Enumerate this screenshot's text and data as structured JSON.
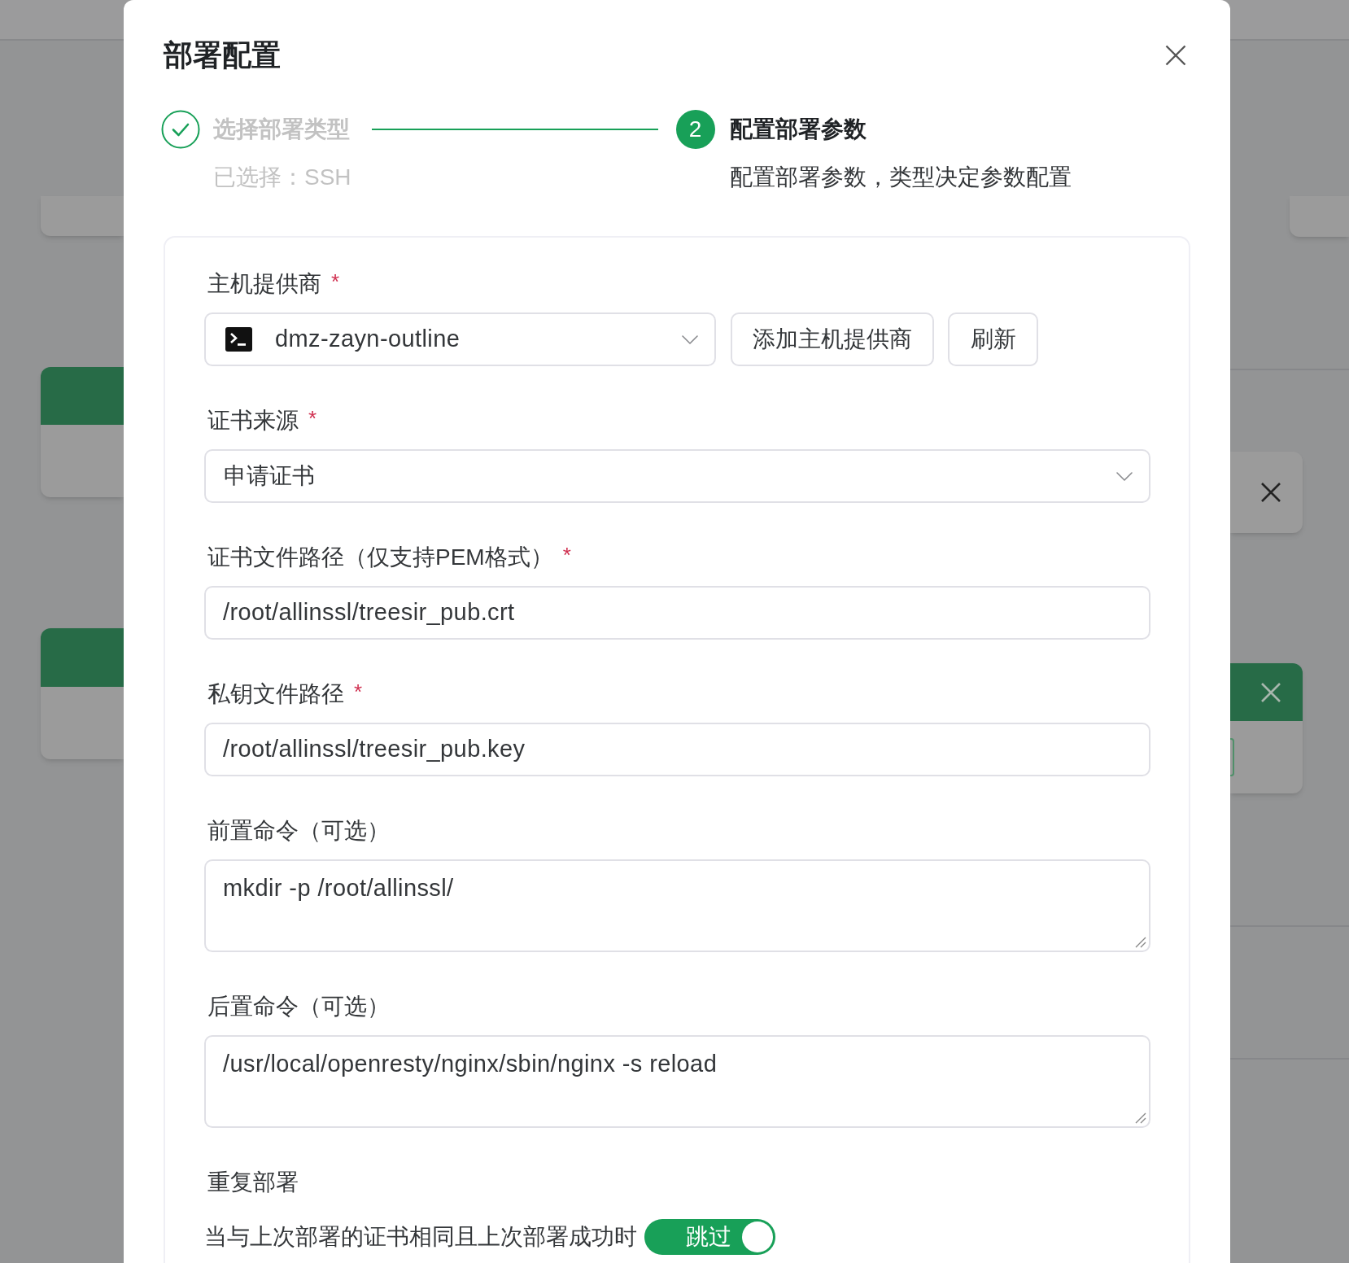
{
  "dialog": {
    "title": "部署配置"
  },
  "steps": [
    {
      "title": "选择部署类型",
      "description": "已选择：SSH",
      "completed": true,
      "active": false
    },
    {
      "number": "2",
      "title": "配置部署参数",
      "description": "配置部署参数，类型决定参数配置",
      "completed": false,
      "active": true
    }
  ],
  "form": {
    "fields": [
      {
        "kind": "select-with-actions",
        "label": "主机提供商",
        "required_mark": "*",
        "value": "dmz-zayn-outline",
        "buttons": [
          "添加主机提供商",
          "刷新"
        ]
      },
      {
        "kind": "select",
        "label": "证书来源",
        "required_mark": "*",
        "value": "申请证书"
      },
      {
        "kind": "input",
        "label": "证书文件路径（仅支持PEM格式）",
        "required_mark": "*",
        "value": "/root/allinssl/treesir_pub.crt"
      },
      {
        "kind": "input",
        "label": "私钥文件路径",
        "required_mark": "*",
        "value": "/root/allinssl/treesir_pub.key"
      },
      {
        "kind": "textarea",
        "label": "前置命令（可选）",
        "value": "mkdir -p /root/allinssl/"
      },
      {
        "kind": "textarea",
        "label": "后置命令（可选）",
        "value": "/usr/local/openresty/nginx/sbin/nginx -s reload"
      },
      {
        "kind": "switch",
        "label": "重复部署",
        "description": "当与上次部署的证书相同且上次部署成功时",
        "on": true,
        "switch_text": "跳过"
      }
    ]
  }
}
